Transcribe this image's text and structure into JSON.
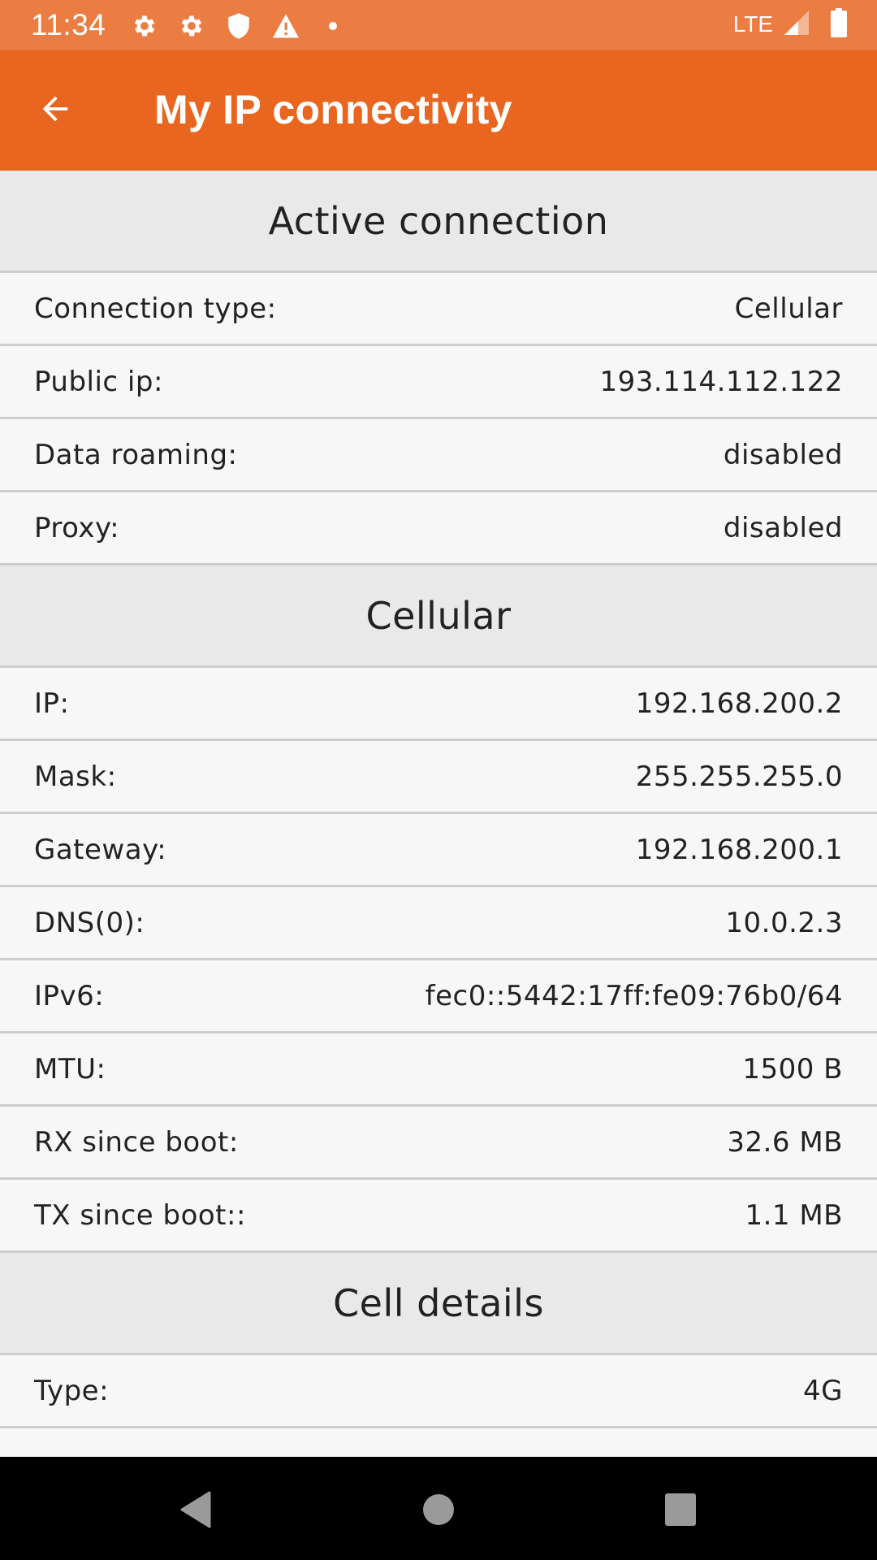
{
  "status_bar": {
    "time": "11:34",
    "icons_left": [
      "settings-gear-icon",
      "settings-gear-icon",
      "shield-icon",
      "warning-icon",
      "notification-dot-icon"
    ],
    "network_label": "LTE",
    "icons_right": [
      "signal-icon",
      "battery-icon"
    ]
  },
  "app_bar": {
    "title": "My IP connectivity",
    "back_icon": "arrow-back-icon"
  },
  "colors": {
    "status_bar": "#eb7d43",
    "app_bar": "#e8661f",
    "section_header_bg": "#e9e9e9",
    "row_bg": "#f7f7f7",
    "divider": "#cdcdcd",
    "nav_bar": "#000000"
  },
  "sections": [
    {
      "title": "Active connection",
      "rows": [
        {
          "label": "Connection type:",
          "value": "Cellular"
        },
        {
          "label": "Public ip:",
          "value": "193.114.112.122"
        },
        {
          "label": "Data roaming:",
          "value": "disabled"
        },
        {
          "label": "Proxy:",
          "value": "disabled"
        }
      ]
    },
    {
      "title": "Cellular",
      "rows": [
        {
          "label": "IP:",
          "value": "192.168.200.2"
        },
        {
          "label": "Mask:",
          "value": "255.255.255.0"
        },
        {
          "label": "Gateway:",
          "value": "192.168.200.1"
        },
        {
          "label": "DNS(0):",
          "value": "10.0.2.3"
        },
        {
          "label": "IPv6:",
          "value": "fec0::5442:17ff:fe09:76b0/64"
        },
        {
          "label": "MTU:",
          "value": "1500 B"
        },
        {
          "label": "RX since boot:",
          "value": "32.6 MB"
        },
        {
          "label": "TX since boot::",
          "value": "1.1 MB"
        }
      ]
    },
    {
      "title": "Cell details",
      "rows": [
        {
          "label": "Type:",
          "value": "4G"
        },
        {
          "label": "",
          "value": ""
        }
      ]
    }
  ],
  "nav_bar": {
    "buttons": [
      "back-triangle-icon",
      "home-circle-icon",
      "recents-square-icon"
    ]
  }
}
